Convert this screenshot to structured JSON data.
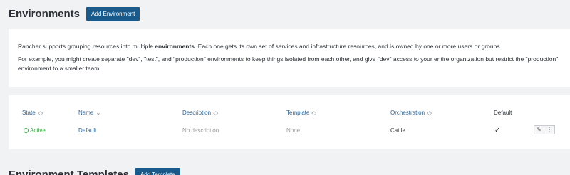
{
  "header": {
    "title": "Environments",
    "add_button": "Add Environment"
  },
  "info": {
    "p1_pre": "Rancher supports grouping resources into multiple ",
    "p1_bold": "environments",
    "p1_post": ". Each one gets its own set of services and infrastructure resources, and is owned by one or more users or groups.",
    "p2": "For example, you might create separate \"dev\", \"test\", and \"production\" environments to keep things isolated from each other, and give \"dev\" access to your entire organization but restrict the \"production\" environment to a smaller team."
  },
  "table": {
    "columns": {
      "state": "State",
      "name": "Name",
      "description": "Description",
      "template": "Template",
      "orchestration": "Orchestration",
      "default": "Default"
    },
    "rows": [
      {
        "state": "Active",
        "name": "Default",
        "description": "No description",
        "template": "None",
        "orchestration": "Cattle",
        "default": "✓"
      }
    ]
  },
  "templates_section": {
    "title": "Environment Templates",
    "add_button": "Add Template"
  },
  "icons": {
    "sort": "sort-icon",
    "check": "check-icon",
    "edit": "pencil-icon",
    "more": "more-vertical-icon"
  },
  "colors": {
    "primary_button": "#1a5a8a",
    "link": "#2d5f8b",
    "active_state": "#3aa547",
    "background": "#f1f2f4"
  }
}
